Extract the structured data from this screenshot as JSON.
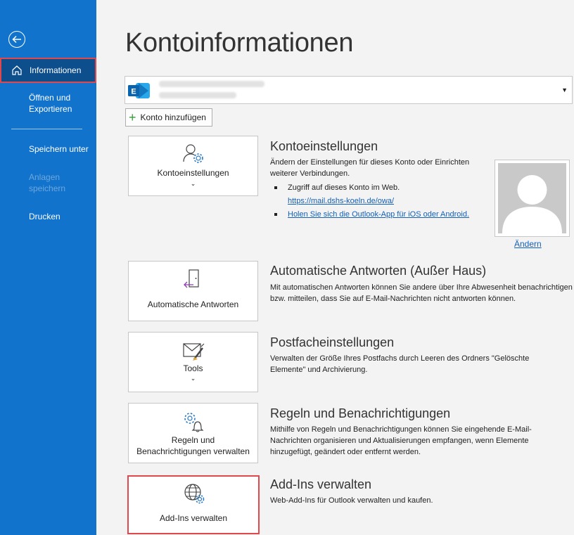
{
  "sidebar": {
    "items": [
      {
        "label": "Informationen"
      },
      {
        "label": "Öffnen und Exportieren"
      },
      {
        "label": "Speichern unter"
      },
      {
        "label": "Anlagen speichern"
      },
      {
        "label": "Drucken"
      }
    ]
  },
  "page": {
    "title": "Kontoinformationen"
  },
  "account": {
    "add_label": "Konto hinzufügen"
  },
  "sections": {
    "account_settings": {
      "tile_label": "Kontoeinstellungen",
      "title": "Kontoeinstellungen",
      "desc": "Ändern der Einstellungen für dieses Konto oder Einrichten weiterer Verbindungen.",
      "bullet1": "Zugriff auf dieses Konto im Web.",
      "bullet1_link": "https://mail.dshs-koeln.de/owa/",
      "bullet2_link": "Holen Sie sich die Outlook-App für iOS oder Android."
    },
    "auto_reply": {
      "tile_label": "Automatische Antworten",
      "title": "Automatische Antworten (Außer Haus)",
      "desc": "Mit automatischen Antworten können Sie andere über Ihre Abwesenheit benachrichtigen bzw. mitteilen, dass Sie auf E-Mail-Nachrichten nicht antworten können."
    },
    "mailbox": {
      "tile_label": "Tools",
      "title": "Postfacheinstellungen",
      "desc": "Verwalten der Größe Ihres Postfachs durch Leeren des Ordners \"Gelöschte Elemente\" und Archivierung."
    },
    "rules": {
      "tile_label": "Regeln und Benachrichtigungen verwalten",
      "title": "Regeln und Benachrichtigungen",
      "desc": "Mithilfe von Regeln und Benachrichtigungen können Sie eingehende E-Mail-Nachrichten organisieren und Aktualisierungen empfangen, wenn Elemente hinzugefügt, geändert oder entfernt werden."
    },
    "addins": {
      "tile_label": "Add-Ins verwalten",
      "title": "Add-Ins verwalten",
      "desc": "Web-Add-Ins für Outlook verwalten und kaufen."
    }
  },
  "profile": {
    "change_label": "Ändern"
  },
  "icons": {
    "back": "back-arrow-icon",
    "home": "home-icon",
    "exchange": "exchange-icon",
    "plus": "plus-icon",
    "person_gear": "person-gear-icon",
    "door_arrow": "door-arrow-icon",
    "mail_brush": "mail-brush-icon",
    "gear_bell": "gear-bell-icon",
    "globe_gear": "globe-gear-icon",
    "chevron": "chevron-down-icon"
  },
  "colors": {
    "sidebar": "#1273cc",
    "selected_nav": "#0d4f8c",
    "highlight": "#e0484d",
    "link": "#1460b8"
  }
}
